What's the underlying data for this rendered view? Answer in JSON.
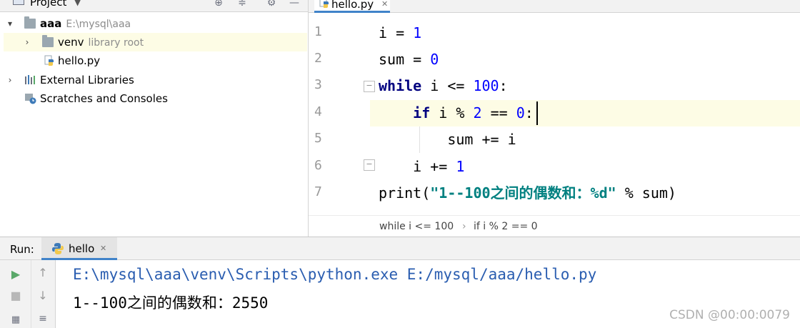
{
  "project_pane": {
    "title": "Project",
    "tree": {
      "root": {
        "name": "aaa",
        "path": "E:\\mysql\\aaa"
      },
      "venv": {
        "name": "venv",
        "hint": "library root"
      },
      "file": {
        "name": "hello.py"
      },
      "external": {
        "name": "External Libraries"
      },
      "scratches": {
        "name": "Scratches and Consoles"
      }
    }
  },
  "editor": {
    "tab": {
      "label": "hello.py"
    },
    "line_numbers": [
      "1",
      "2",
      "3",
      "4",
      "5",
      "6",
      "7"
    ],
    "code": {
      "l1": {
        "a": "i = ",
        "b": "1"
      },
      "l2": {
        "a": "sum = ",
        "b": "0"
      },
      "l3": {
        "kw": "while",
        "a": " i <= ",
        "b": "100",
        "c": ":"
      },
      "l4": {
        "indent": "    ",
        "kw": "if",
        "a": " i % ",
        "b": "2",
        "c": " == ",
        "d": "0",
        "e": ":"
      },
      "l5": {
        "a": "        sum += i"
      },
      "l6": {
        "a": "    i += ",
        "b": "1"
      },
      "l7": {
        "a": "print(",
        "str": "\"1--100之间的偶数和：%d\"",
        "b": " % sum)"
      }
    },
    "breadcrumb": {
      "first": "while i <= 100",
      "sep": "›",
      "second": "if i % 2 == 0"
    }
  },
  "run_panel": {
    "label": "Run:",
    "tab": {
      "label": "hello"
    },
    "console": {
      "command": "E:\\mysql\\aaa\\venv\\Scripts\\python.exe E:/mysql/aaa/hello.py",
      "output": "1--100之间的偶数和：2550"
    }
  },
  "watermark": "CSDN @00:00:0079",
  "colors": {
    "accent": "#4083c9",
    "run_green": "#59a869",
    "keyword": "#000080",
    "number": "#0000ff",
    "string": "#008080",
    "current_line": "#fdfce5"
  }
}
